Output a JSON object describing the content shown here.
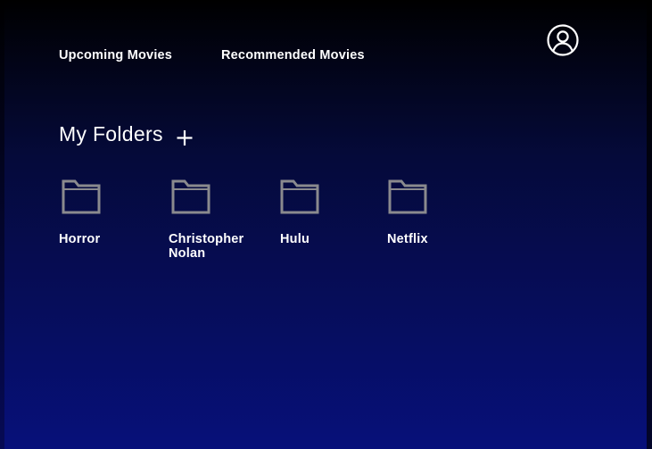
{
  "nav": {
    "upcoming_label": "Upcoming Movies",
    "recommended_label": "Recommended Movies",
    "profile_icon": "user-circle-icon"
  },
  "folders_section": {
    "title": "My Folders",
    "add_icon": "plus-icon",
    "items": [
      {
        "label": "Horror",
        "icon": "folder-icon"
      },
      {
        "label": "Christopher Nolan",
        "icon": "folder-icon"
      },
      {
        "label": "Hulu",
        "icon": "folder-icon"
      },
      {
        "label": "Netflix",
        "icon": "folder-icon"
      }
    ]
  },
  "colors": {
    "background_top": "#000000",
    "background_bottom": "#07107a",
    "text": "#ffffff",
    "folder_icon": "#8a8a8e"
  }
}
